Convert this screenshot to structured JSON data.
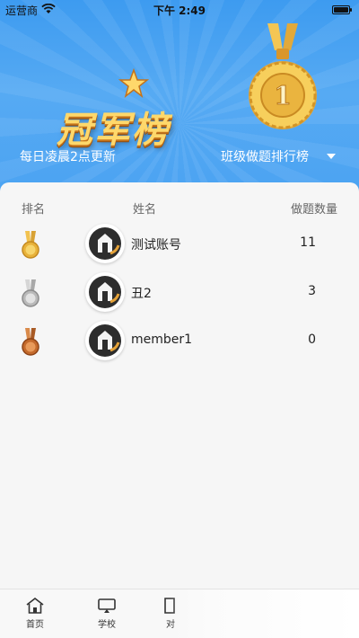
{
  "status_bar": {
    "carrier": "运营商",
    "time": "下午 2:49"
  },
  "header": {
    "title_art": "冠军榜",
    "update_note": "每日凌晨2点更新",
    "ranking_selector": "班级做题排行榜"
  },
  "colors": {
    "header_blue": "#4aa2f2",
    "gold": "#e8b23a",
    "silver": "#b9b9b9",
    "bronze": "#c46a2c"
  },
  "table": {
    "headers": {
      "rank": "排名",
      "name": "姓名",
      "count": "做题数量"
    },
    "rows": [
      {
        "medal": "gold-medal-icon",
        "name": "测试账号",
        "count": "11"
      },
      {
        "medal": "silver-medal-icon",
        "name": "丑2",
        "count": "3"
      },
      {
        "medal": "bronze-medal-icon",
        "name": "member1",
        "count": "0"
      }
    ]
  },
  "tabbar": {
    "items": [
      {
        "icon": "home-icon",
        "label": "首页"
      },
      {
        "icon": "monitor-icon",
        "label": "学校"
      },
      {
        "icon": "document-icon",
        "label": "对"
      }
    ]
  }
}
